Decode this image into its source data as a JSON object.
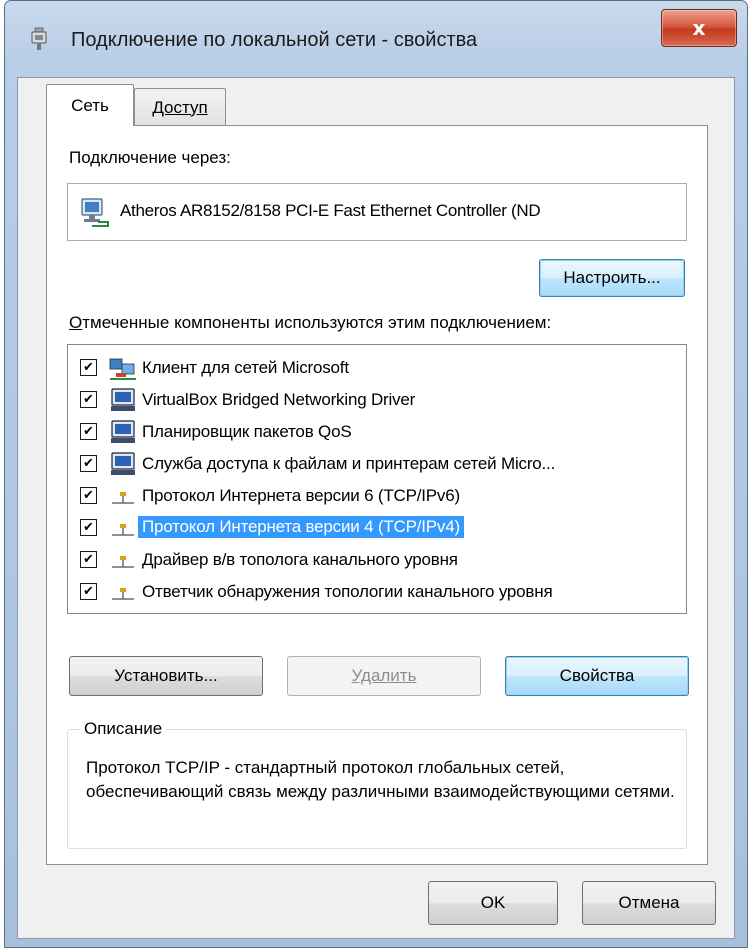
{
  "window": {
    "title": "Подключение по локальной сети - свойства",
    "close_glyph": "x"
  },
  "tabs": [
    {
      "label": "Сеть",
      "active": true
    },
    {
      "label": "Доступ",
      "active": false
    }
  ],
  "network": {
    "connect_via_label": "Подключение через:",
    "adapter_name": "Atheros AR8152/8158 PCI-E Fast Ethernet Controller (ND",
    "configure_button": "Настроить...",
    "components_label": "Отмеченные компоненты используются этим подключением:",
    "components": [
      {
        "label": "Клиент для сетей Microsoft",
        "checked": true,
        "icon": "network-client-icon",
        "selected": false
      },
      {
        "label": "VirtualBox Bridged Networking Driver",
        "checked": true,
        "icon": "network-service-icon",
        "selected": false
      },
      {
        "label": "Планировщик пакетов QoS",
        "checked": true,
        "icon": "network-service-icon",
        "selected": false
      },
      {
        "label": "Служба доступа к файлам и принтерам сетей Micro...",
        "checked": true,
        "icon": "network-service-icon",
        "selected": false
      },
      {
        "label": "Протокол Интернета версии 6 (TCP/IPv6)",
        "checked": true,
        "icon": "network-protocol-icon",
        "selected": false
      },
      {
        "label": "Протокол Интернета версии 4 (TCP/IPv4)",
        "checked": true,
        "icon": "network-protocol-icon",
        "selected": true
      },
      {
        "label": "Драйвер в/в тополога канального уровня",
        "checked": true,
        "icon": "network-protocol-icon",
        "selected": false
      },
      {
        "label": "Ответчик обнаружения топологии канального уровня",
        "checked": true,
        "icon": "network-protocol-icon",
        "selected": false
      }
    ],
    "install_button": "Установить...",
    "remove_button": "Удалить",
    "properties_button": "Свойства",
    "description_title": "Описание",
    "description_text": "Протокол TCP/IP - стандартный протокол глобальных сетей, обеспечивающий связь между различными взаимодействующими сетями."
  },
  "footer": {
    "ok_button": "OK",
    "cancel_button": "Отмена"
  },
  "colors": {
    "selection": "#3399ff",
    "close_button": "#c8452a",
    "default_button": "#bee6fd"
  }
}
